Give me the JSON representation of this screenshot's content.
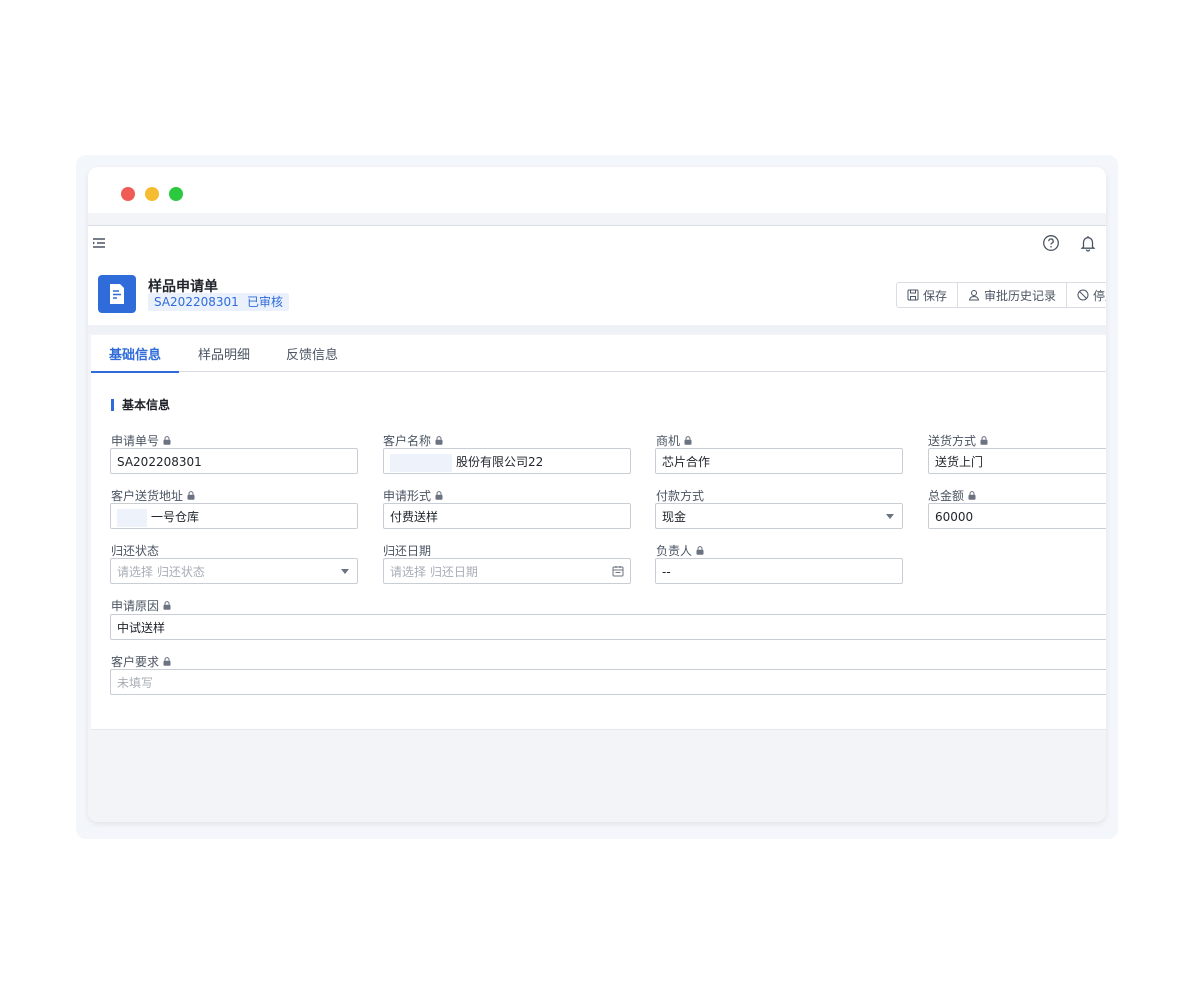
{
  "header": {
    "title": "样品申请单",
    "code": "SA202208301",
    "status": "已审核"
  },
  "actions": {
    "save": "保存",
    "history": "审批历史记录",
    "disable": "停用"
  },
  "tabs": [
    {
      "label": "基础信息",
      "active": true
    },
    {
      "label": "样品明细",
      "active": false
    },
    {
      "label": "反馈信息",
      "active": false
    }
  ],
  "section": {
    "title": "基本信息"
  },
  "fields": {
    "apply_no": {
      "label": "申请单号",
      "value": "SA202208301"
    },
    "customer_name": {
      "label": "客户名称",
      "value": "股份有限公司22"
    },
    "opportunity": {
      "label": "商机",
      "value": "芯片合作"
    },
    "delivery_method": {
      "label": "送货方式",
      "value": "送货上门"
    },
    "customer_address": {
      "label": "客户送货地址",
      "value": "一号仓库"
    },
    "apply_form": {
      "label": "申请形式",
      "value": "付费送样"
    },
    "payment_method": {
      "label": "付款方式",
      "value": "现金"
    },
    "total_amount": {
      "label": "总金额",
      "value": "60000"
    },
    "return_status": {
      "label": "归还状态",
      "placeholder": "请选择 归还状态"
    },
    "return_date": {
      "label": "归还日期",
      "placeholder": "请选择 归还日期"
    },
    "owner": {
      "label": "负责人",
      "value": "--"
    },
    "apply_reason": {
      "label": "申请原因",
      "value": "中试送样"
    },
    "customer_requirement": {
      "label": "客户要求",
      "placeholder": "未填写"
    }
  },
  "colors": {
    "accent": "#2f6bd9",
    "tag_bg": "#eaf1fd",
    "traffic_red": "#f15b55",
    "traffic_yellow": "#f6bc2f",
    "traffic_green": "#2bc840"
  }
}
